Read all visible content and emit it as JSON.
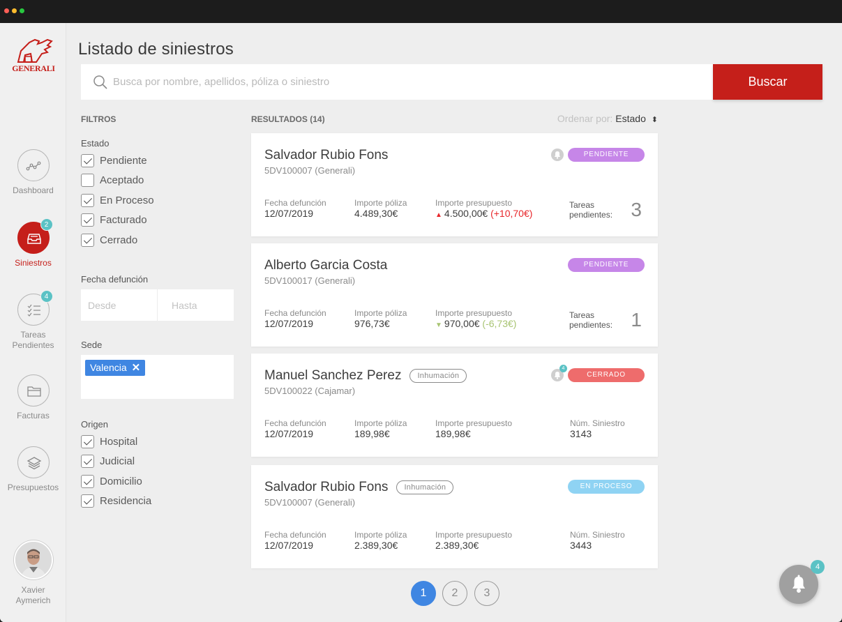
{
  "brand": {
    "logo_text": "GENERALI"
  },
  "sidebar": {
    "items": [
      {
        "label": "Dashboard",
        "icon": "dashboard-chart-icon",
        "badge": "",
        "active": false
      },
      {
        "label": "Siniestros",
        "icon": "inbox-icon",
        "badge": "2",
        "active": true
      },
      {
        "label": "Tareas Pendientes",
        "icon": "checklist-icon",
        "badge": "4",
        "active": false
      },
      {
        "label": "Facturas",
        "icon": "folder-icon",
        "badge": "",
        "active": false
      },
      {
        "label": "Presupuestos",
        "icon": "layers-icon",
        "badge": "",
        "active": false
      }
    ],
    "user": {
      "name_line1": "Xavier",
      "name_line2": "Aymerich"
    }
  },
  "page": {
    "title": "Listado de siniestros"
  },
  "search": {
    "placeholder": "Busca por nombre, apellidos, póliza o siniestro",
    "value": "",
    "button_label": "Buscar"
  },
  "filters": {
    "title": "FILTROS",
    "estado": {
      "label": "Estado",
      "options": [
        {
          "label": "Pendiente",
          "checked": true
        },
        {
          "label": "Aceptado",
          "checked": false
        },
        {
          "label": "En Proceso",
          "checked": true
        },
        {
          "label": "Facturado",
          "checked": true
        },
        {
          "label": "Cerrado",
          "checked": true
        }
      ]
    },
    "fecha": {
      "label": "Fecha defunción",
      "desde_placeholder": "Desde",
      "hasta_placeholder": "Hasta"
    },
    "sede": {
      "label": "Sede",
      "tags": [
        "Valencia"
      ]
    },
    "origen": {
      "label": "Origen",
      "options": [
        {
          "label": "Hospital",
          "checked": true
        },
        {
          "label": "Judicial",
          "checked": true
        },
        {
          "label": "Domicilio",
          "checked": true
        },
        {
          "label": "Residencia",
          "checked": true
        }
      ]
    }
  },
  "results": {
    "header": "RESULTADOS (14)",
    "sort_label": "Ordenar por:",
    "sort_value": "Estado",
    "cards": [
      {
        "name": "Salvador Rubio Fons",
        "chip": "",
        "policy": "5DV100007 (Generali)",
        "status": "PENDIENTE",
        "status_color": "#c686e8",
        "has_bell": true,
        "bell_badge": "",
        "fecha_label": "Fecha defunción",
        "fecha": "12/07/2019",
        "poliza_label": "Importe póliza",
        "poliza": "4.489,30€",
        "presupuesto_label": "Importe presupuesto",
        "presupuesto": "4.500,00€",
        "delta": "(+10,70€)",
        "trend": "up",
        "last_label_1": "Tareas",
        "last_label_2": "pendientes:",
        "last_value": "3",
        "last_type": "tareas"
      },
      {
        "name": "Alberto Garcia Costa",
        "chip": "",
        "policy": "5DV100017 (Generali)",
        "status": "PENDIENTE",
        "status_color": "#c686e8",
        "has_bell": false,
        "bell_badge": "",
        "fecha_label": "Fecha defunción",
        "fecha": "12/07/2019",
        "poliza_label": "Importe póliza",
        "poliza": "976,73€",
        "presupuesto_label": "Importe presupuesto",
        "presupuesto": "970,00€",
        "delta": "(-6,73€)",
        "trend": "down",
        "last_label_1": "Tareas",
        "last_label_2": "pendientes:",
        "last_value": "1",
        "last_type": "tareas"
      },
      {
        "name": "Manuel Sanchez Perez",
        "chip": "Inhumación",
        "policy": "5DV100022 (Cajamar)",
        "status": "CERRADO",
        "status_color": "#ee6c6c",
        "has_bell": true,
        "bell_badge": "4",
        "fecha_label": "Fecha defunción",
        "fecha": "12/07/2019",
        "poliza_label": "Importe póliza",
        "poliza": "189,98€",
        "presupuesto_label": "Importe presupuesto",
        "presupuesto": "189,98€",
        "delta": "",
        "trend": "none",
        "last_label_1": "Núm. Siniestro",
        "last_label_2": "",
        "last_value": "3143",
        "last_type": "num"
      },
      {
        "name": "Salvador Rubio Fons",
        "chip": "Inhumación",
        "policy": "5DV100007 (Generali)",
        "status": "EN PROCESO",
        "status_color": "#8fd3f3",
        "has_bell": false,
        "bell_badge": "",
        "fecha_label": "Fecha defunción",
        "fecha": "12/07/2019",
        "poliza_label": "Importe póliza",
        "poliza": "2.389,30€",
        "presupuesto_label": "Importe presupuesto",
        "presupuesto": "2.389,30€",
        "delta": "",
        "trend": "none",
        "last_label_1": "Núm. Siniestro",
        "last_label_2": "",
        "last_value": "3443",
        "last_type": "num"
      }
    ]
  },
  "pagination": {
    "pages": [
      "1",
      "2",
      "3"
    ],
    "current": "1"
  },
  "notifications": {
    "badge": "4"
  },
  "colors": {
    "brand_red": "#c51f1a",
    "accent_blue": "#3f86e2",
    "badge_teal": "#5bc2c5"
  }
}
